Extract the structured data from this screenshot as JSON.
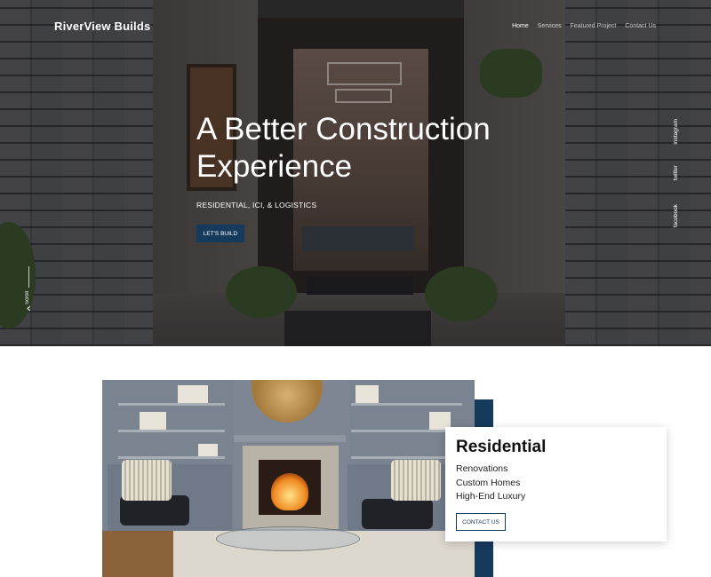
{
  "brand": {
    "name": "RiverView Builds"
  },
  "nav": {
    "items": [
      {
        "label": "Home",
        "active": true
      },
      {
        "label": "Services",
        "active": false
      },
      {
        "label": "Featured Project",
        "active": false
      },
      {
        "label": "Contact Us",
        "active": false
      }
    ]
  },
  "hero": {
    "title_line1": "A Better Construction",
    "title_line2": "Experience",
    "subtitle": "RESIDENTIAL, ICI, & LOGISTICS",
    "cta_label": "LET'S BUILD",
    "scroll_label": "Scroll",
    "scroll_icon": "chevron-left-icon",
    "social": [
      "instagram",
      "twitter",
      "facebook"
    ]
  },
  "services_card": {
    "title": "Residential",
    "items": [
      "Renovations",
      "Custom Homes",
      "High-End Luxury"
    ],
    "cta_label": "CONTACT US"
  },
  "colors": {
    "accent": "#163a5c",
    "hero_overlay": "#0a0a0c",
    "text_light": "#ffffff",
    "text_dark": "#111111"
  }
}
